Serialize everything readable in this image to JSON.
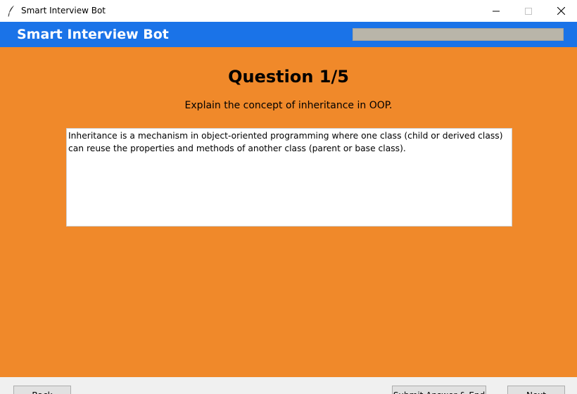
{
  "window": {
    "title": "Smart Interview Bot",
    "controls": {
      "minimize": "minimize-icon",
      "maximize": "maximize-icon",
      "close": "close-icon"
    }
  },
  "header": {
    "brand": "Smart Interview Bot",
    "progress_fraction": 0
  },
  "question": {
    "heading": "Question 1/5",
    "text": "Explain the concept of inheritance in OOP."
  },
  "answer": {
    "value": "Inheritance is a mechanism in object-oriented programming where one class (child or derived class) can reuse the properties and methods of another class (parent or base class)."
  },
  "footer": {
    "back_label": "Back",
    "submit_label": "Submit Answer & End",
    "next_label": "Next"
  },
  "colors": {
    "header_bg": "#1a73e8",
    "main_bg": "#f0892a",
    "progress_track": "#b9b5a9"
  }
}
